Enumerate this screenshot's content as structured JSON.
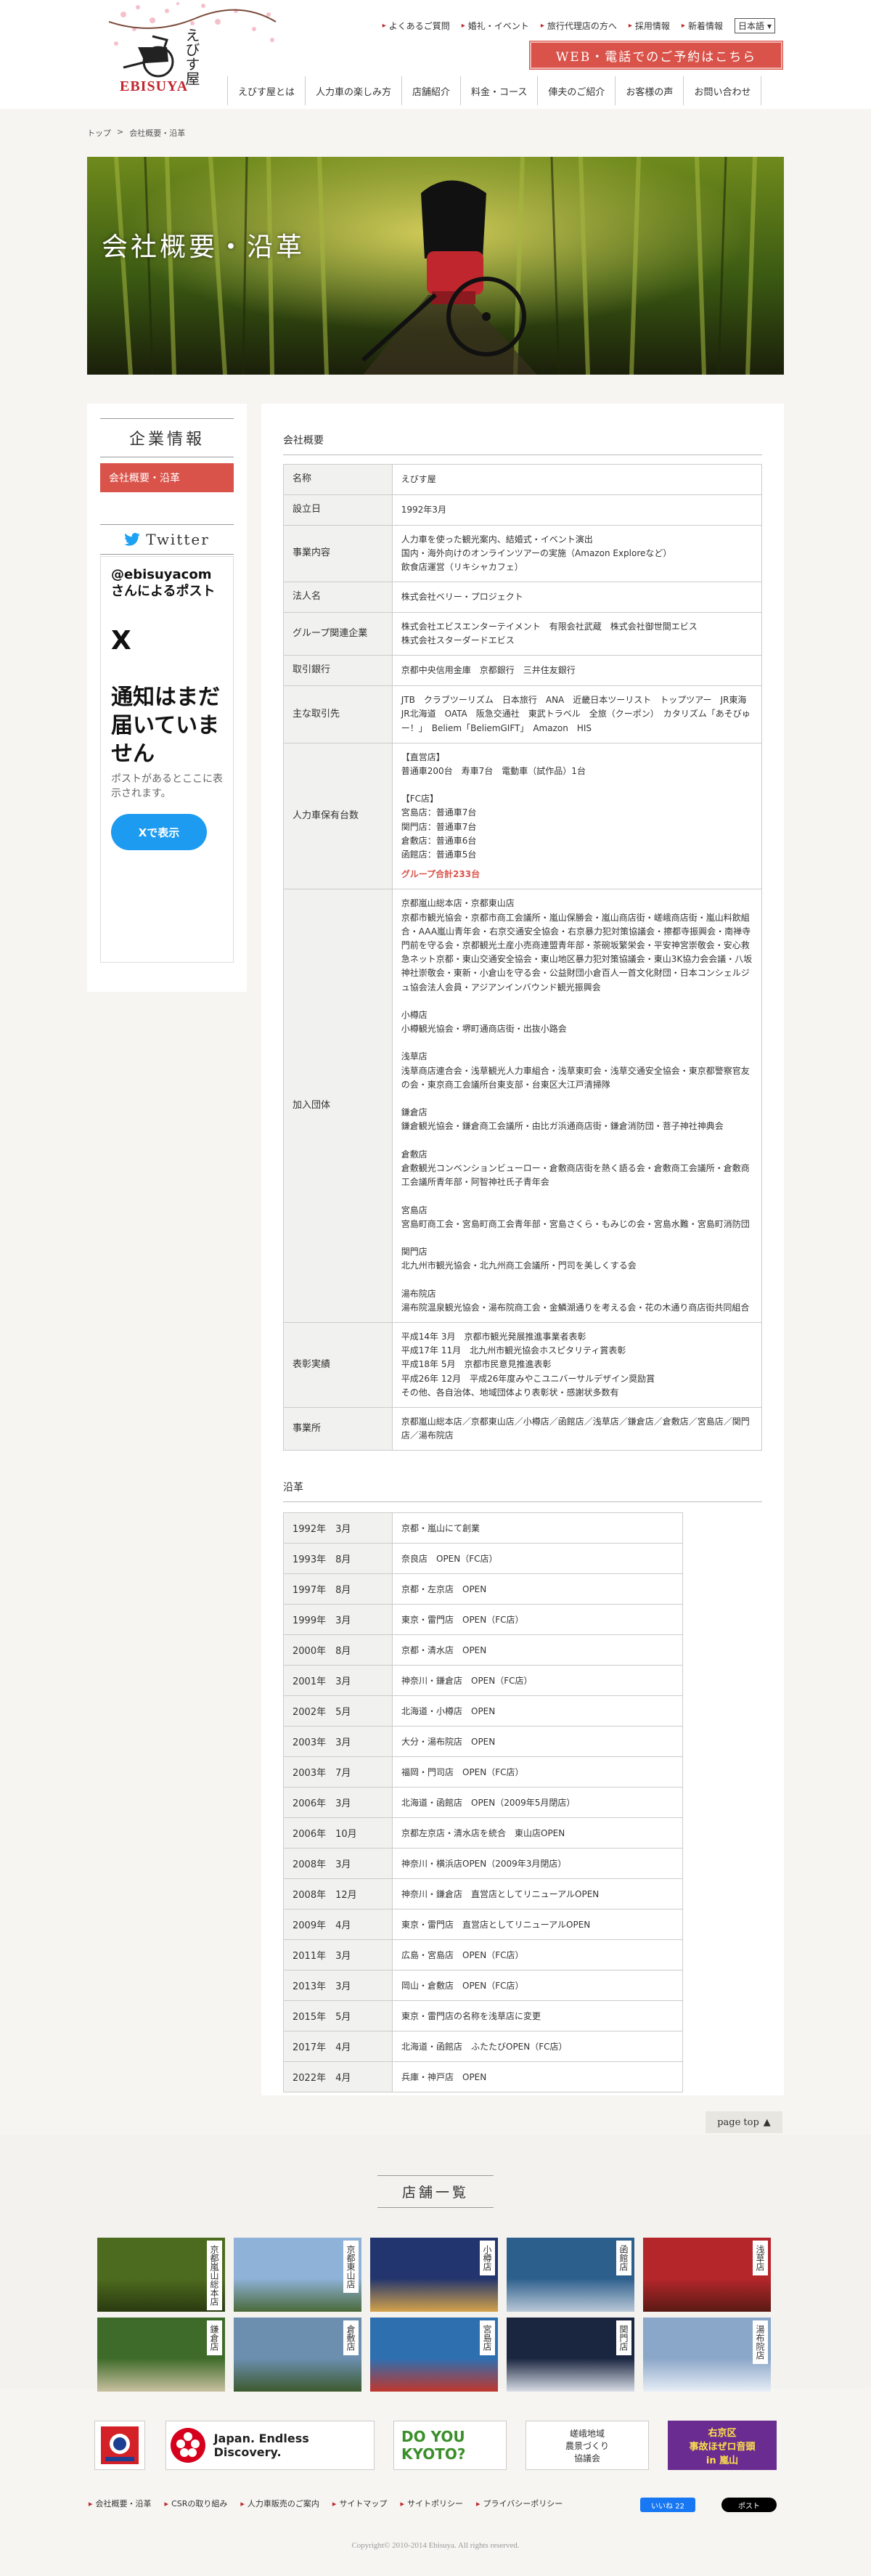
{
  "header": {
    "logo_jp": "えびす屋",
    "logo_en": "EBISUYA",
    "top_links": [
      "よくあるご質問",
      "婚礼・イベント",
      "旅行代理店の方へ",
      "採用情報",
      "新着情報"
    ],
    "language": "日本語",
    "reserve_button": "WEB・電話でのご予約はこちら",
    "nav": [
      "えびす屋とは",
      "人力車の楽しみ方",
      "店舗紹介",
      "料金・コース",
      "俥夫のご紹介",
      "お客様の声",
      "お問い合わせ"
    ]
  },
  "breadcrumb": {
    "home": "トップ",
    "sep": ">",
    "current": "会社概要・沿革"
  },
  "hero": {
    "title": "会社概要・沿革"
  },
  "sidebar": {
    "title": "企業情報",
    "active_item": "会社概要・沿革",
    "twitter_title": "Twitter",
    "tw_user": "@ebisuyacomさんによるポスト",
    "tw_x": "X",
    "tw_empty": "通知はまだ届いていません",
    "tw_desc": "ポストがあるとここに表示されます。",
    "tw_button": "Xで表示"
  },
  "company": {
    "title": "会社概要",
    "rows": [
      {
        "k": "名称",
        "v": "えびす屋"
      },
      {
        "k": "設立日",
        "v": "1992年3月"
      },
      {
        "k": "事業内容",
        "v": "人力車を使った観光案内、結婚式・イベント演出\n国内・海外向けのオンラインツアーの実施（Amazon Exploreなど）\n飲食店運営（リキシャカフェ）"
      },
      {
        "k": "法人名",
        "v": "株式会社ベリー・プロジェクト"
      },
      {
        "k": "グループ関連企業",
        "v": "株式会社エビスエンターテイメント　有限会社武蔵　株式会社御世間エビス\n株式会社スターダードエビス"
      },
      {
        "k": "取引銀行",
        "v": "京都中央信用金庫　京都銀行　三井住友銀行"
      },
      {
        "k": "主な取引先",
        "v": "JTB　クラブツーリズム　日本旅行　ANA　近畿日本ツーリスト　トップツアー　JR東海　JR北海道　OATA　阪急交通社　東武トラベル　全旅（クーポン）　カタリズム「あそびゅー！」　Beliem「BeliemGIFT」　Amazon　HIS"
      },
      {
        "k": "人力車保有台数",
        "v": "【直営店】\n普通車200台　寿車7台　電動車（試作品）1台\n\n【FC店】\n宮島店：普通車7台\n関門店：普通車7台\n倉敷店：普通車6台\n函館店：普通車5台",
        "extra": "グループ合計233台"
      },
      {
        "k": "加入団体",
        "v": "京都嵐山総本店・京都東山店\n京都市観光協会・京都市商工会議所・嵐山保勝会・嵐山商店街・嵯峨商店街・嵐山料飲組合・AAA嵐山青年会・右京交通安全協会・右京暴力犯対策協議会・擦都寺振興会・南禅寺門前を守る会・京都観光土産小売商連盟青年部・茶碗坂繁栄会・平安神宮崇敬会・安心救急ネット京都・東山交通安全協会・東山地区暴力犯対策協議会・東山3K協力会会議・八坂神社崇敬会・東新・小倉山を守る会・公益財団小倉百人一首文化財団・日本コンシェルジュ協会法人会員・アジアンインバウンド観光振興会\n\n小樽店\n小樽観光協会・堺町通商店街・出抜小路会\n\n浅草店\n浅草商店連合会・浅草観光人力車組合・浅草東町会・浅草交通安全協会・東京都警察官友の会・東京商工会議所台東支部・台東区大江戸清掃隊\n\n鎌倉店\n鎌倉観光協会・鎌倉商工会議所・由比ガ浜通商店街・鎌倉消防団・菩子神社神典会\n\n倉敷店\n倉敷観光コンベンションビューロー・倉敷商店街を熱く語る会・倉敷商工会議所・倉敷商工会議所青年部・阿智神社氏子青年会\n\n宮島店\n宮島町商工会・宮島町商工会青年部・宮島さくら・もみじの会・宮島水難・宮島町消防団\n\n関門店\n北九州市観光協会・北九州商工会議所・門司を美しくする会\n\n湯布院店\n湯布院温泉観光協会・湯布院商工会・金鱗湖通りを考える会・花の木通り商店街共同組合"
      },
      {
        "k": "表彰実績",
        "v": "平成14年 3月　京都市観光発展推進事業者表彰\n平成17年 11月　北九州市観光協会ホスピタリティ賞表彰\n平成18年 5月　京都市民意見推進表彰\n平成26年 12月　平成26年度みやこユニバーサルデザイン奨励賞\nその他、各自治体、地域団体より表彰状・感謝状多数有"
      },
      {
        "k": "事業所",
        "v": "京都嵐山総本店／京都東山店／小樽店／函館店／浅草店／鎌倉店／倉敷店／宮島店／関門店／湯布院店"
      }
    ]
  },
  "history": {
    "title": "沿革",
    "rows": [
      {
        "k": "1992年　3月",
        "v": "京都・嵐山にて創業"
      },
      {
        "k": "1993年　8月",
        "v": "奈良店　OPEN（FC店）"
      },
      {
        "k": "1997年　8月",
        "v": "京都・左京店　OPEN"
      },
      {
        "k": "1999年　3月",
        "v": "東京・雷門店　OPEN（FC店）"
      },
      {
        "k": "2000年　8月",
        "v": "京都・清水店　OPEN"
      },
      {
        "k": "2001年　3月",
        "v": "神奈川・鎌倉店　OPEN（FC店）"
      },
      {
        "k": "2002年　5月",
        "v": "北海道・小樽店　OPEN"
      },
      {
        "k": "2003年　3月",
        "v": "大分・湯布院店　OPEN"
      },
      {
        "k": "2003年　7月",
        "v": "福岡・門司店　OPEN（FC店）"
      },
      {
        "k": "2006年　3月",
        "v": "北海道・函館店　OPEN（2009年5月閉店）"
      },
      {
        "k": "2006年　10月",
        "v": "京都左京店・清水店を統合　東山店OPEN"
      },
      {
        "k": "2008年　3月",
        "v": "神奈川・横浜店OPEN（2009年3月閉店）"
      },
      {
        "k": "2008年　12月",
        "v": "神奈川・鎌倉店　直営店としてリニューアルOPEN"
      },
      {
        "k": "2009年　4月",
        "v": "東京・雷門店　直営店としてリニューアルOPEN"
      },
      {
        "k": "2011年　3月",
        "v": "広島・宮島店　OPEN（FC店）"
      },
      {
        "k": "2013年　3月",
        "v": "岡山・倉敷店　OPEN（FC店）"
      },
      {
        "k": "2015年　5月",
        "v": "東京・雷門店の名称を浅草店に変更"
      },
      {
        "k": "2017年　4月",
        "v": "北海道・函館店　ふたたびOPEN（FC店）"
      },
      {
        "k": "2022年　4月",
        "v": "兵庫・神戸店　OPEN"
      }
    ]
  },
  "pagetop": "page top",
  "shops": {
    "title": "店舗一覧",
    "items": [
      "京都嵐山総本店",
      "京都東山店",
      "小樽店",
      "函館店",
      "浅草店",
      "鎌倉店",
      "倉敷店",
      "宮島店",
      "関門店",
      "湯布院店"
    ]
  },
  "banners": {
    "b2": "Japan. Endless Discovery.",
    "b3_a": "DO YOU",
    "b3_b": "KYOTO?",
    "b4_a": "嵯峨地域",
    "b4_b": "農景づくり",
    "b4_c": "協議会",
    "b5_a": "右京区",
    "b5_b": "事故ほぜロ音頭",
    "b5_c": "in 嵐山"
  },
  "footer": {
    "links": [
      "会社概要・沿革",
      "CSRの取り組み",
      "人力車販売のご案内",
      "サイトマップ",
      "サイトポリシー",
      "プライバシーポリシー"
    ],
    "fb": "いいね 22",
    "x": "ポスト",
    "copyright": "Copyright© 2010-2014 Ebisuya. All rights reserved."
  }
}
